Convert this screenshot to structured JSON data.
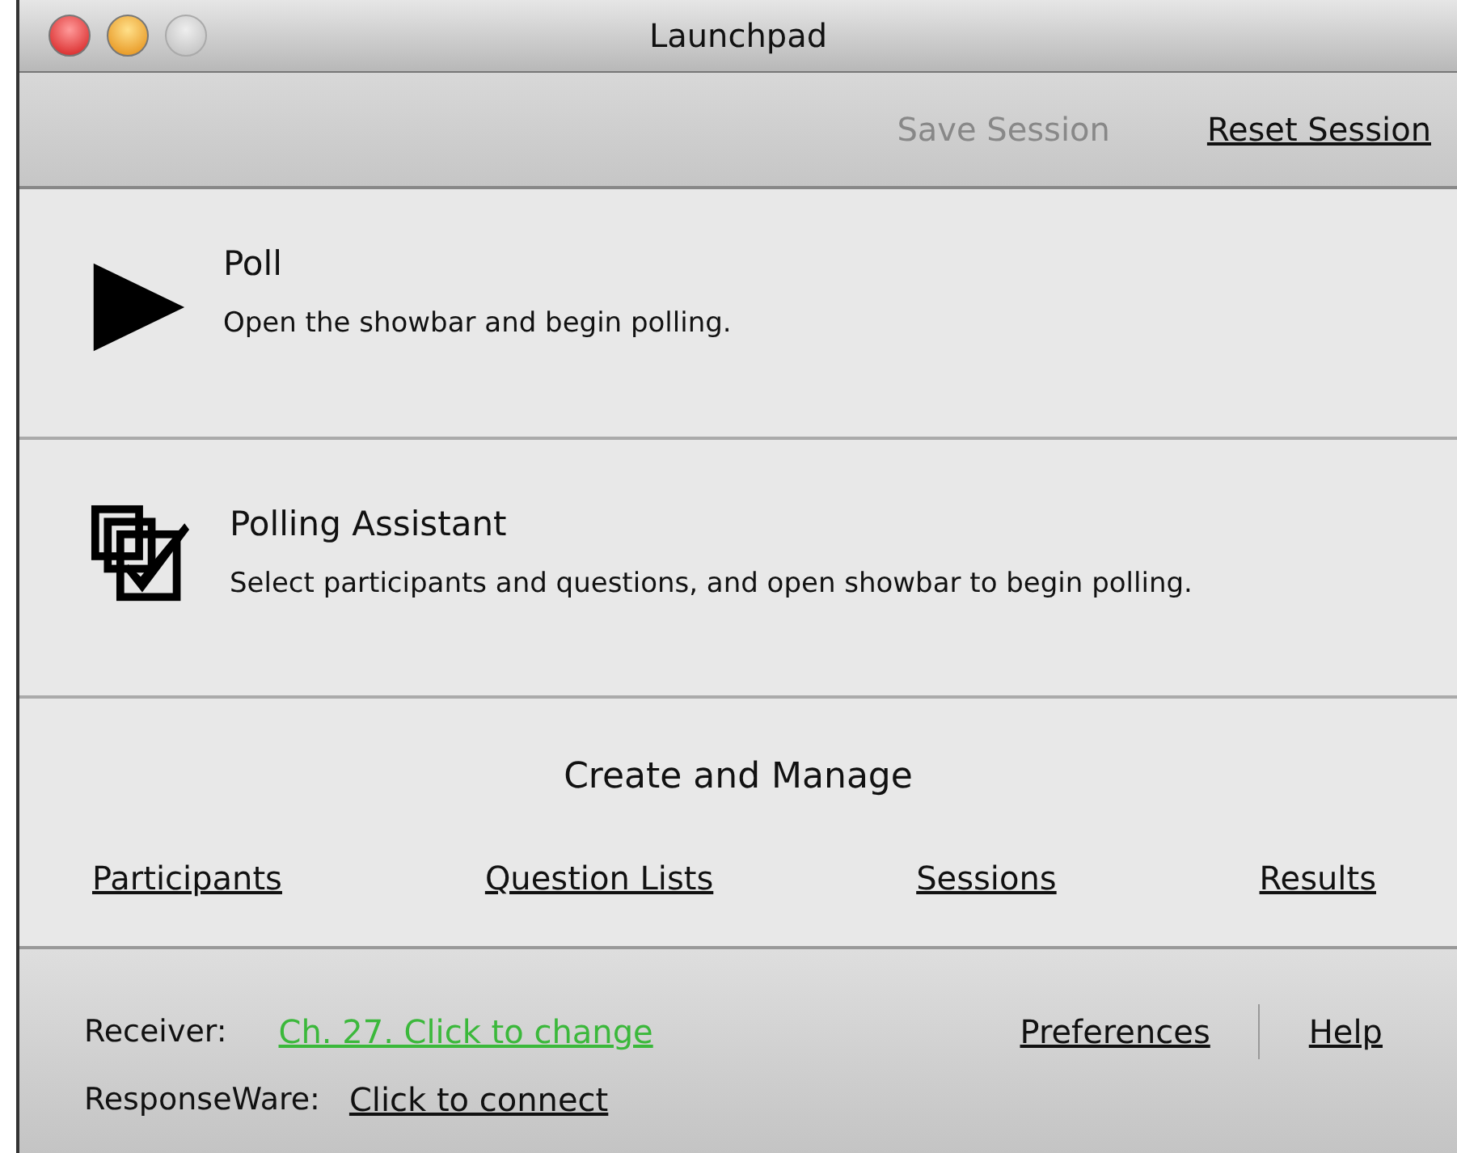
{
  "window": {
    "title": "Launchpad"
  },
  "toolbar": [
    {
      "label": "Save Session",
      "disabled": true
    },
    {
      "label": "Reset Session",
      "disabled": false
    }
  ],
  "actions": [
    {
      "kind": "play",
      "title": "Poll",
      "description": "Open the showbar and begin polling."
    },
    {
      "kind": "checklist",
      "title": "Polling Assistant",
      "description": "Select participants and questions, and open showbar to begin polling."
    }
  ],
  "manage": {
    "heading": "Create and Manage",
    "links": [
      "Participants",
      "Question Lists",
      "Sessions",
      "Results"
    ]
  },
  "footer": {
    "receiver_label": "Receiver:",
    "receiver_value": "Ch. 27. Click to change",
    "responseware_label": "ResponseWare:",
    "responseware_value": "Click to connect",
    "links": [
      "Preferences",
      "Help"
    ]
  }
}
